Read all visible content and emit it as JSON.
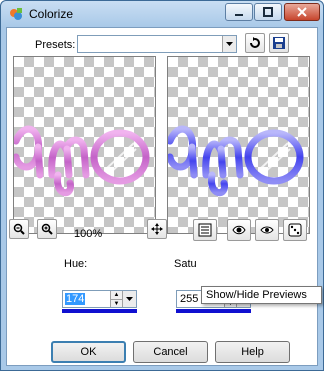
{
  "window": {
    "title": "Colorize"
  },
  "presets": {
    "label": "Presets:",
    "value": ""
  },
  "toolbar": {
    "zoom_level": "100%",
    "tooltip": "Show/Hide Previews"
  },
  "hue": {
    "label": "Hue:",
    "value": "174"
  },
  "saturation": {
    "label": "Satu",
    "value": "255"
  },
  "buttons": {
    "ok": "OK",
    "cancel": "Cancel",
    "help": "Help"
  },
  "preview": {
    "text": "amo"
  },
  "colors": {
    "original_tint": "#c463c8",
    "colorized_tint": "#4444ee",
    "slider_bar": "#1010d0"
  }
}
